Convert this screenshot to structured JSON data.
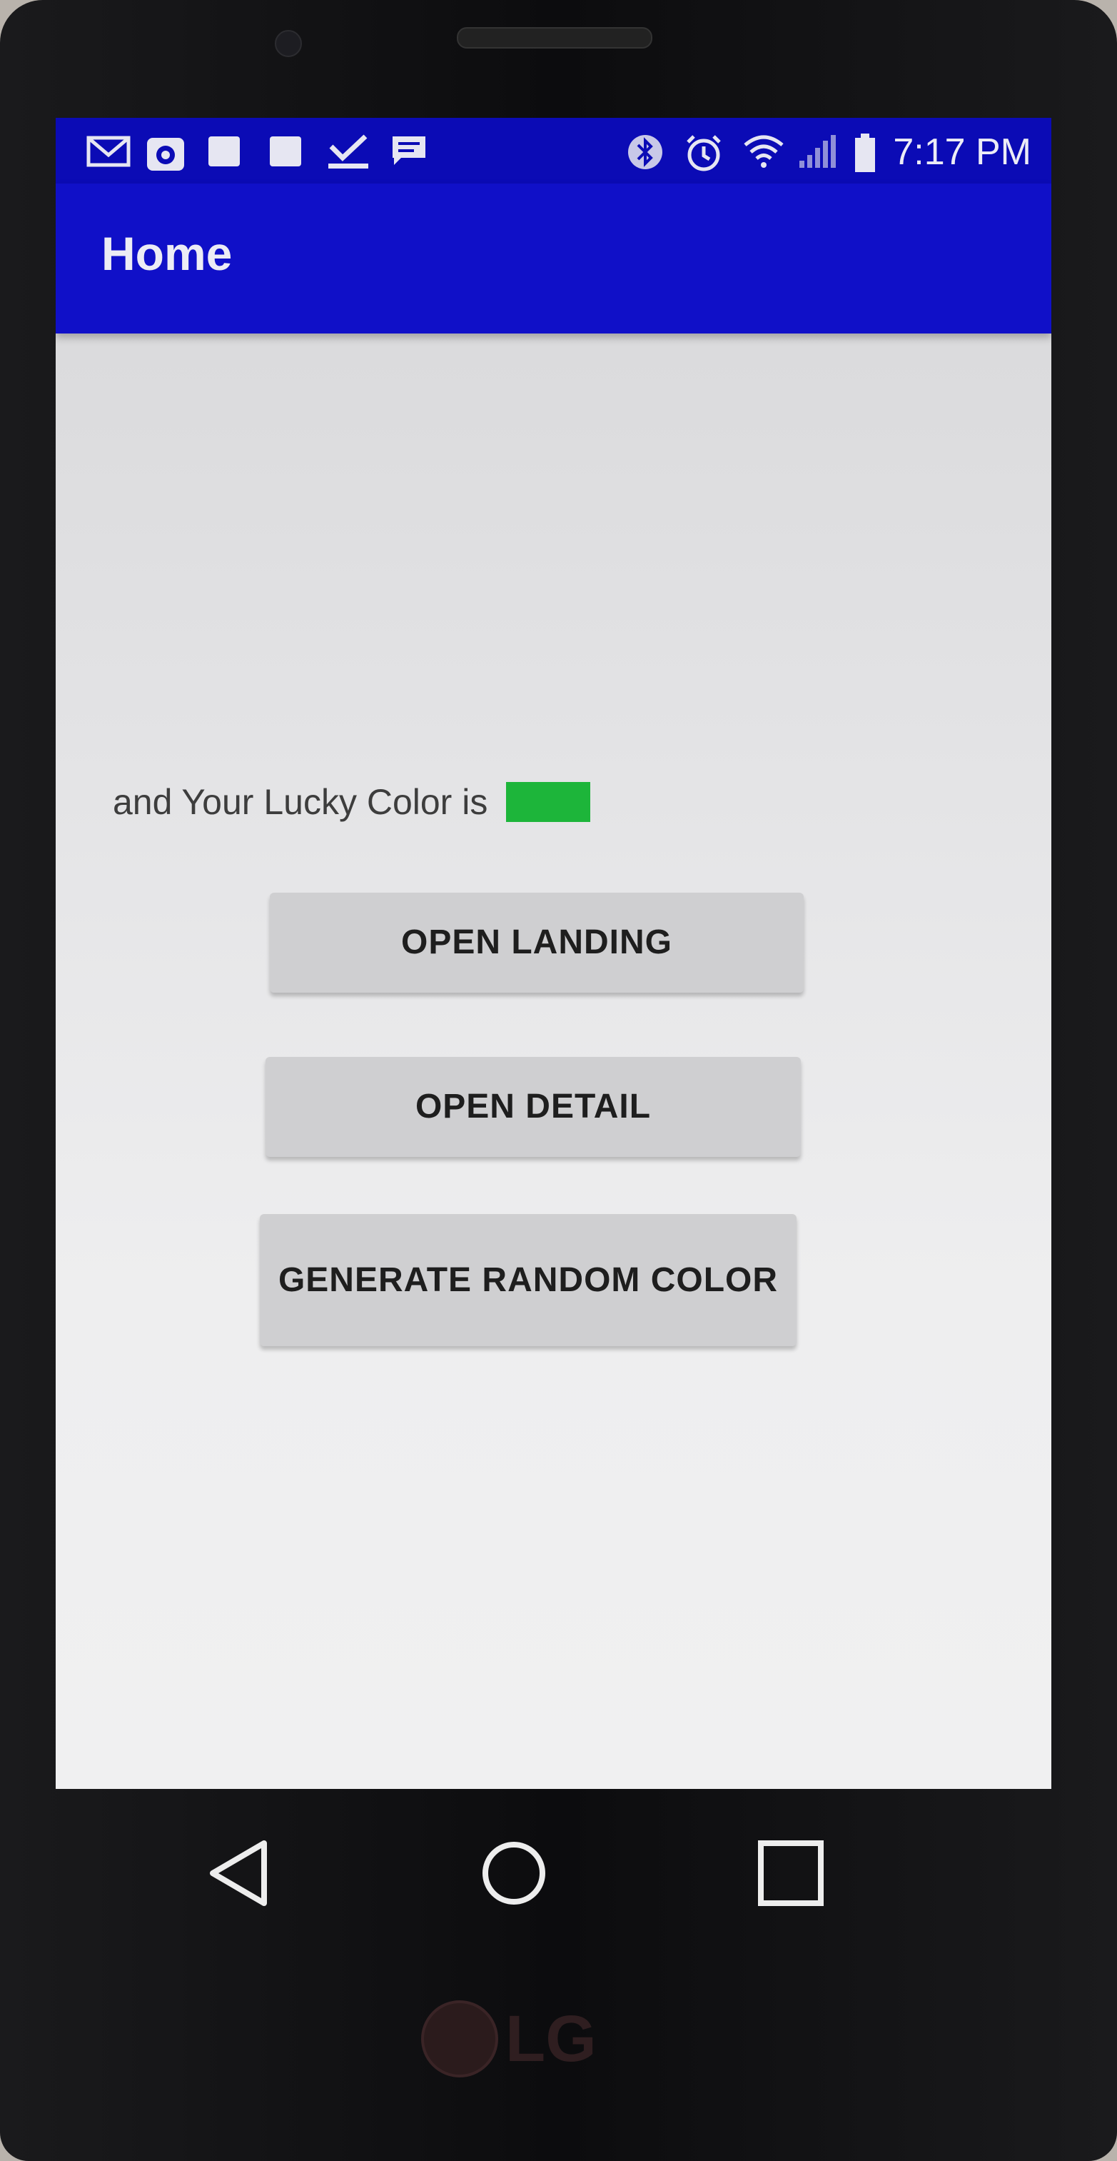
{
  "status_bar": {
    "time": "7:17 PM",
    "icons": [
      "gmail-icon",
      "camera-app-icon",
      "notification-square-icon",
      "notification-square-icon",
      "download-done-icon",
      "message-icon",
      "bluetooth-icon",
      "alarm-icon",
      "wifi-icon",
      "signal-icon",
      "battery-icon"
    ]
  },
  "app_bar": {
    "title": "Home"
  },
  "main": {
    "lucky_text": "and Your Lucky Color is",
    "lucky_color": "#1db53a",
    "buttons": {
      "open_landing": "OPEN LANDING",
      "open_detail": "OPEN DETAIL",
      "generate_random_color": "GENERATE RANDOM COLOR"
    }
  },
  "nav_bar": {
    "icons": [
      "back-icon",
      "home-icon",
      "recents-icon"
    ]
  },
  "device": {
    "brand": "LG"
  },
  "colors": {
    "status_bar": "#0b0bb5",
    "app_bar": "#1010c8",
    "button_bg": "#cfcfd1"
  }
}
